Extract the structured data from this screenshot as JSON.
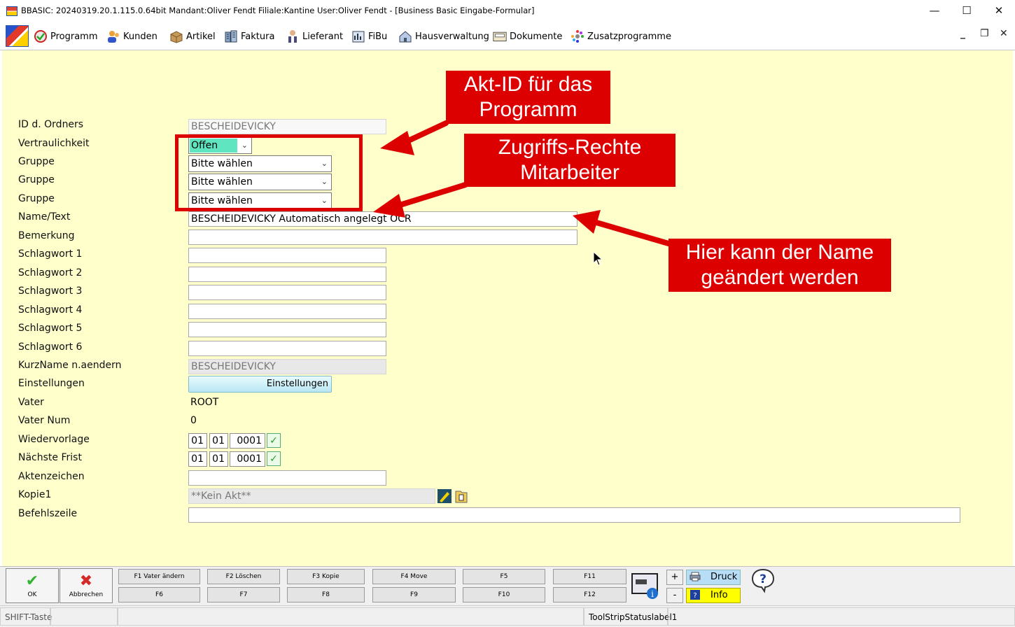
{
  "window": {
    "title": "BBASIC: 20240319.20.1.115.0.64bit Mandant:Oliver Fendt Filiale:Kantine User:Oliver Fendt - [Business Basic Eingabe-Formular]",
    "minimize": "—",
    "maximize": "☐",
    "close": "✕"
  },
  "menu": {
    "items": [
      {
        "label": "Programm",
        "icon": "program-icon"
      },
      {
        "label": "Kunden",
        "icon": "customers-icon"
      },
      {
        "label": "Artikel",
        "icon": "box-icon"
      },
      {
        "label": "Faktura",
        "icon": "invoice-icon"
      },
      {
        "label": "Lieferant",
        "icon": "supplier-icon"
      },
      {
        "label": "FiBu",
        "icon": "accounting-icon"
      },
      {
        "label": "Hausverwaltung",
        "icon": "house-icon"
      },
      {
        "label": "Dokumente",
        "icon": "document-icon"
      },
      {
        "label": "Zusatzprogramme",
        "icon": "addons-icon"
      }
    ],
    "mdi_minimize": "_",
    "mdi_restore": "❐",
    "mdi_close": "✕"
  },
  "form": {
    "labels": {
      "ordner_id": "ID d. Ordners",
      "vertraulichkeit": "Vertraulichkeit",
      "gruppe1": "Gruppe",
      "gruppe2": "Gruppe",
      "gruppe3": "Gruppe",
      "name": "Name/Text",
      "bemerkung": "Bemerkung",
      "schlagwort1": "Schlagwort 1",
      "schlagwort2": "Schlagwort 2",
      "schlagwort3": "Schlagwort 3",
      "schlagwort4": "Schlagwort 4",
      "schlagwort5": "Schlagwort 5",
      "schlagwort6": "Schlagwort 6",
      "kurzname": "KurzName n.aendern",
      "einstellungen": "Einstellungen",
      "vater": "Vater",
      "vater_num": "Vater Num",
      "wiedervorlage": "Wiedervorlage",
      "naechste_frist": "Nächste Frist",
      "aktenzeichen": "Aktenzeichen",
      "kopie1": "Kopie1",
      "befehlszeile": "Befehlszeile"
    },
    "values": {
      "ordner_id": "BESCHEIDEVICKY",
      "vertraulichkeit": "Offen",
      "gruppe1": "Bitte wählen",
      "gruppe2": "Bitte wählen",
      "gruppe3": "Bitte wählen",
      "name": "BESCHEIDEVICKY Automatisch angelegt OCR",
      "bemerkung": "",
      "schlagwort1": "",
      "schlagwort2": "",
      "schlagwort3": "",
      "schlagwort4": "",
      "schlagwort5": "",
      "schlagwort6": "",
      "kurzname": "BESCHEIDEVICKY",
      "einstellungen_button": "Einstellungen",
      "vater": "ROOT",
      "vater_num": "0",
      "wiedervorlage": {
        "day": "01",
        "month": "01",
        "year": "0001"
      },
      "naechste_frist": {
        "day": "01",
        "month": "01",
        "year": "0001"
      },
      "aktenzeichen": "",
      "kopie1": "**Kein Akt**",
      "befehlszeile": ""
    }
  },
  "annotations": {
    "akt_id": "Akt-ID für das Programm",
    "zugriff": "Zugriffs-Rechte Mitarbeiter",
    "name_change": "Hier kann der Name geändert werden",
    "color": "#dd0000"
  },
  "bottom": {
    "ok": "OK",
    "cancel": "Abbrechen",
    "fkeys_top": [
      "F1 Vater ändern",
      "F2 Löschen",
      "F3 Kopie",
      "F4 Move",
      "F5",
      "F11"
    ],
    "fkeys_bottom": [
      "F6",
      "F7",
      "F8",
      "F9",
      "F10",
      "F12"
    ],
    "plus": "+",
    "minus": "-",
    "druck": "Druck",
    "info": "Info",
    "help": "?"
  },
  "status": {
    "shift": "SHIFT-Taste",
    "label1": "ToolStripStatuslabel1"
  }
}
